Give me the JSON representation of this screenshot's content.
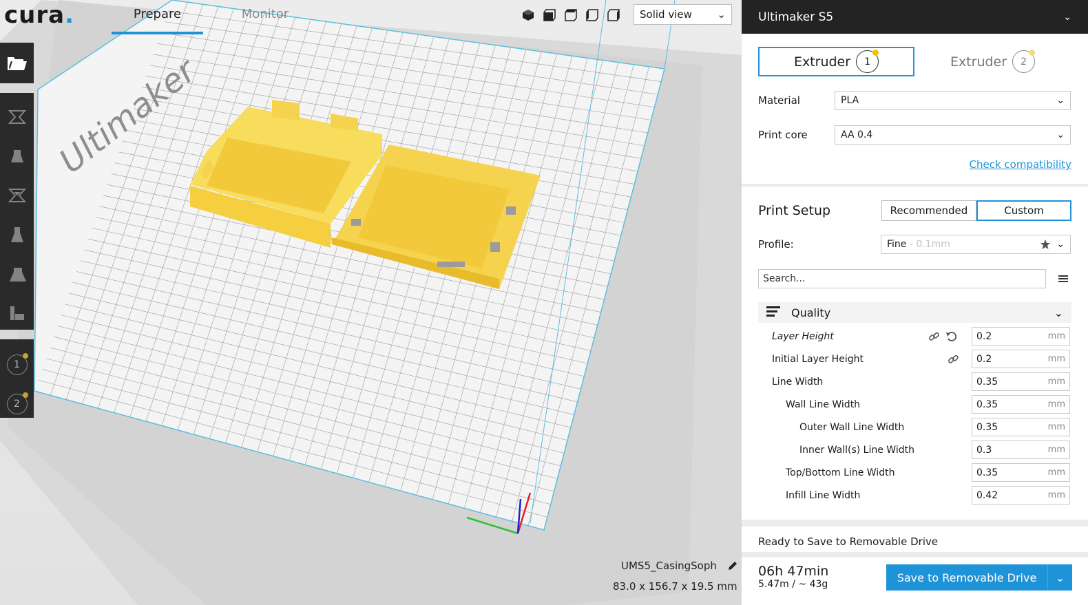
{
  "app": {
    "logo": "cura",
    "logo_dot": "."
  },
  "tabs": {
    "prepare": "Prepare",
    "monitor": "Monitor"
  },
  "view": {
    "mode_label": "Solid view",
    "icons": [
      "3d-view-icon",
      "front-view-icon",
      "top-view-icon",
      "left-view-icon",
      "right-view-icon"
    ]
  },
  "left_toolbar": {
    "open_icon": "folder-open-icon",
    "tools": [
      "move-icon",
      "scale-icon",
      "rotate-icon",
      "mirror-icon",
      "per-model-settings-icon",
      "support-blocker-icon"
    ],
    "extruders": [
      "1",
      "2"
    ]
  },
  "scene": {
    "plate_brand": "Ultimaker"
  },
  "job": {
    "name": "UMS5_CasingSoph",
    "dimensions": "83.0 x 156.7 x 19.5 mm"
  },
  "panel": {
    "printer": "Ultimaker S5",
    "extruder_tab_label": "Extruder",
    "extruder_1_num": "1",
    "extruder_2_num": "2",
    "material_label": "Material",
    "material_value": "PLA",
    "core_label": "Print core",
    "core_value": "AA 0.4",
    "check_compat": "Check compatibility"
  },
  "setup": {
    "title": "Print Setup",
    "recommended": "Recommended",
    "custom": "Custom",
    "profile_label": "Profile:",
    "profile_value": "Fine",
    "profile_sub": " - 0.1mm",
    "search_placeholder": "Search...",
    "category": "Quality",
    "settings": [
      {
        "name": "Layer Height",
        "value": "0.2",
        "unit": "mm",
        "indent": 0,
        "italic": true,
        "icons": [
          "link-icon",
          "reset-icon"
        ]
      },
      {
        "name": "Initial Layer Height",
        "value": "0.2",
        "unit": "mm",
        "indent": 0,
        "italic": false,
        "icons": [
          "link-icon"
        ]
      },
      {
        "name": "Line Width",
        "value": "0.35",
        "unit": "mm",
        "indent": 0,
        "italic": false,
        "icons": []
      },
      {
        "name": "Wall Line Width",
        "value": "0.35",
        "unit": "mm",
        "indent": 1,
        "italic": false,
        "icons": []
      },
      {
        "name": "Outer Wall Line Width",
        "value": "0.35",
        "unit": "mm",
        "indent": 2,
        "italic": false,
        "icons": []
      },
      {
        "name": "Inner Wall(s) Line Width",
        "value": "0.3",
        "unit": "mm",
        "indent": 2,
        "italic": false,
        "icons": []
      },
      {
        "name": "Top/Bottom Line Width",
        "value": "0.35",
        "unit": "mm",
        "indent": 1,
        "italic": false,
        "icons": []
      },
      {
        "name": "Infill Line Width",
        "value": "0.42",
        "unit": "mm",
        "indent": 1,
        "italic": false,
        "icons": []
      }
    ]
  },
  "status": {
    "ready": "Ready to Save to Removable Drive",
    "time": "06h 47min",
    "material": "5.47m / ~ 43g",
    "save_label": "Save to Removable Drive"
  },
  "colors": {
    "accent": "#1f93d8",
    "model": "#f5d34e",
    "toolbar": "#2a2a2a",
    "header": "#232323"
  }
}
